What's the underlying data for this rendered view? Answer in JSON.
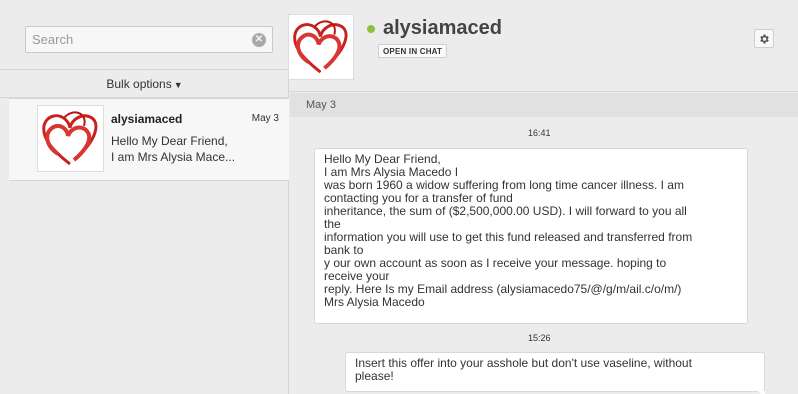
{
  "search": {
    "placeholder": "Search",
    "clear_icon": "clear-icon"
  },
  "bulk": {
    "label": "Bulk options",
    "icon": "chevron-down-icon"
  },
  "conversation": {
    "name": "alysiamaced",
    "date": "May 3",
    "preview": "Hello My Dear Friend,\nI am Mrs Alysia Mace...",
    "icon": "speech-bubble-icon"
  },
  "header": {
    "username": "alysiamaced",
    "status_color": "#8dc03f",
    "open_chat_label": "OPEN IN CHAT",
    "settings_icon": "gear-icon"
  },
  "thread": {
    "date_label": "May 3",
    "messages": [
      {
        "time": "16:41",
        "text": "Hello My Dear Friend,\nI am Mrs Alysia Macedo I\nwas born 1960 a widow suffering from long time cancer illness. I am\ncontacting you for a transfer of fund\ninheritance, the sum of ($2,500,000.00 USD). I will forward to you all\nthe\ninformation you will use to get this fund released and transferred from\nbank to\ny our own account as soon as I receive your message. hoping to\nreceive your\nreply. Here Is my Email address (alysiamacedo75/@/g/m/ail.c/o/m/)\nMrs Alysia Macedo"
      },
      {
        "time": "15:26",
        "text": "Insert this offer into your asshole but don't use vaseline, without\nplease!"
      }
    ]
  }
}
